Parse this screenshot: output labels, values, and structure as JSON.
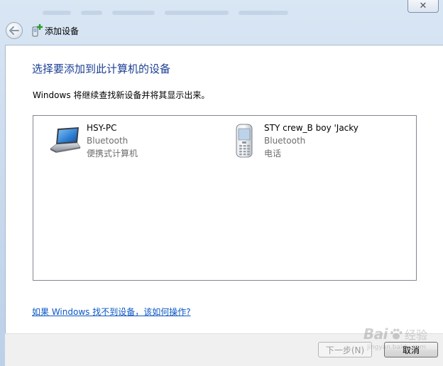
{
  "window": {
    "title": "添加设备",
    "close_glyph": "✕"
  },
  "page": {
    "main_instruction": "选择要添加到此计算机的设备",
    "sub_text": "Windows 将继续查找新设备并将其显示出来。",
    "help_link": "如果 Windows 找不到设备，该如何操作?"
  },
  "devices": [
    {
      "name": "HSY-PC",
      "type": "Bluetooth",
      "category": "便携式计算机",
      "icon": "laptop-icon"
    },
    {
      "name": "STY crew_B boy 'Jacky",
      "type": "Bluetooth",
      "category": "电话",
      "icon": "mobile-phone-icon"
    }
  ],
  "buttons": {
    "next": "下一步(N)",
    "cancel": "取消"
  },
  "watermark": {
    "brand": "Bai",
    "suffix": "经验",
    "url": "jingyan.baidu.com"
  },
  "colors": {
    "instruction": "#1c3f94",
    "link": "#0b57c5",
    "frame": "#c7d8ec"
  }
}
